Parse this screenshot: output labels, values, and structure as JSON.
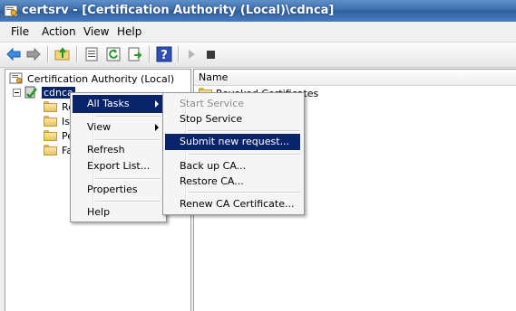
{
  "window": {
    "title": "certsrv - [Certification Authority (Local)\\cdnca]"
  },
  "menubar": {
    "items": [
      "File",
      "Action",
      "View",
      "Help"
    ]
  },
  "toolbar": {
    "icons": [
      "back-arrow-icon",
      "forward-arrow-icon",
      "up-folder-icon",
      "properties-icon",
      "refresh-icon",
      "export-list-icon",
      "help-icon",
      "start-service-icon",
      "stop-service-icon"
    ]
  },
  "tree": {
    "root": "Certification Authority (Local)",
    "node": "cdnca",
    "children": [
      "Re",
      "Is",
      "Pe",
      "Fa"
    ]
  },
  "list": {
    "column_name": "Name",
    "rows": [
      "Revoked Certificates"
    ]
  },
  "context_menu": {
    "items": [
      "All Tasks",
      "View",
      "Refresh",
      "Export List...",
      "Properties",
      "Help"
    ]
  },
  "submenu": {
    "items": [
      "Start Service",
      "Stop Service",
      "Submit new request...",
      "Back up CA...",
      "Restore CA...",
      "Renew CA Certificate..."
    ]
  },
  "colors": {
    "highlight": "#0a246a",
    "titlebar": "#3e6fae"
  }
}
